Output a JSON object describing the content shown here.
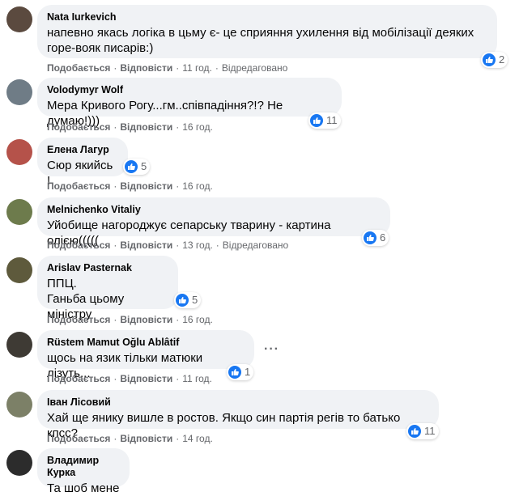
{
  "labels": {
    "like": "Подобається",
    "reply": "Відповісти",
    "edited": "Відредаговано"
  },
  "comments": [
    {
      "name": "Nata Iurkevich",
      "text": "напевно якась логіка в цьму є- це сприяння ухилення від мобілізації деяких\nгоре-вояк писарів:)",
      "time": "11 год.",
      "reactions": "2",
      "avatar_color": "#5b4a3f"
    },
    {
      "name": "Volodymyr Wolf",
      "text": "Мера Кривого Рогу...гм..співпадіння?!? Не думаю!)))",
      "time": "16 год.",
      "reactions": "11",
      "avatar_color": "#6f7c86"
    },
    {
      "name": "Елена Лагур",
      "text": "Сюр якийсь !",
      "time": "16 год.",
      "reactions": "5",
      "avatar_color": "#b5524a"
    },
    {
      "name": "Melnichenko Vitaliy",
      "text": "Уйобище нагороджує сепарську тварину - картина олією(((((",
      "time": "13 год.",
      "reactions": "6",
      "avatar_color": "#6d7b4c"
    },
    {
      "name": "Arislav Pasternak",
      "text": "ППЦ.\nГаньба цьому міністру",
      "time": "16 год.",
      "reactions": "5",
      "avatar_color": "#5e5a3c"
    },
    {
      "name": "Rüstem Mamut Oğlu Ablâtif",
      "text": "щось на язик тільки матюки лізуть...",
      "time": "11 год.",
      "reactions": "1",
      "avatar_color": "#3e3a34"
    },
    {
      "name": "Іван Лісовий",
      "text": "Хай ще янику вишле в ростов. Якщо син партія регів то батько кпсс?",
      "time": "14 год.",
      "reactions": "11",
      "avatar_color": "#7c8067"
    },
    {
      "name": "Владимир Курка",
      "text": "Та шоб мене",
      "avatar_color": "#2c2c2c"
    }
  ],
  "colors": {
    "like_blue": "#1877f2",
    "bubble": "#f0f2f5",
    "meta": "#65676b"
  },
  "icons": {
    "like": "thumbs-up-icon",
    "more": "more-options-icon"
  }
}
